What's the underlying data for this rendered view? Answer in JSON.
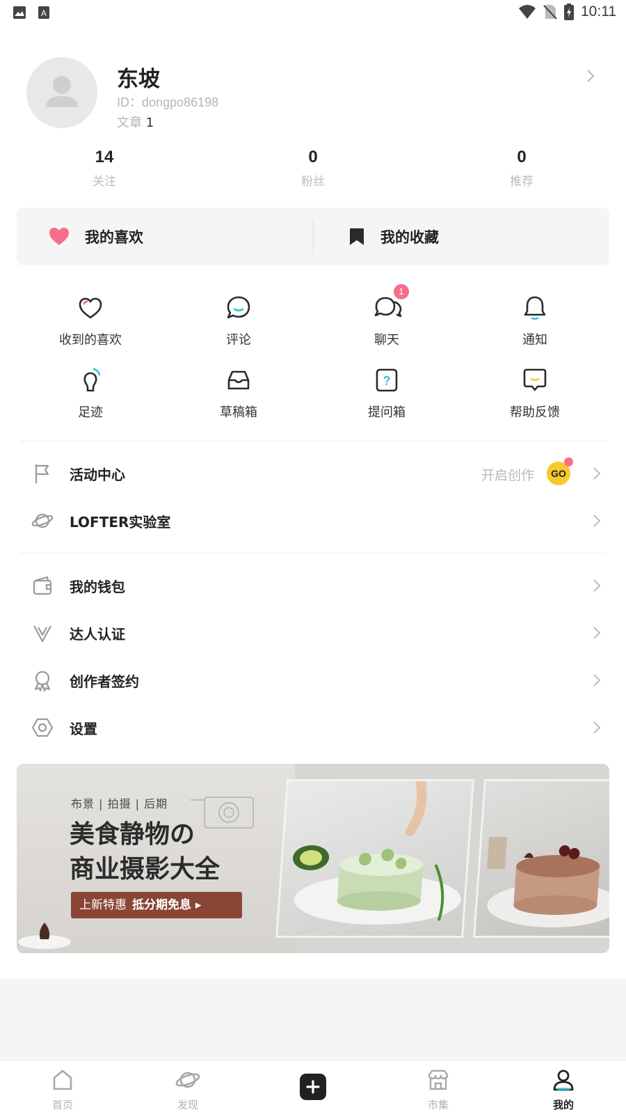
{
  "status_bar": {
    "time": "10:11"
  },
  "profile": {
    "name": "东坡",
    "id_text": "ID：dongpo86198",
    "articles_label": "文章",
    "articles_count": "1"
  },
  "stats": [
    {
      "num": "14",
      "label": "关注"
    },
    {
      "num": "0",
      "label": "粉丝"
    },
    {
      "num": "0",
      "label": "推荐"
    }
  ],
  "card": {
    "likes_label": "我的喜欢",
    "collections_label": "我的收藏"
  },
  "grid": [
    {
      "label": "收到的喜欢",
      "icon": "heart-outline-icon"
    },
    {
      "label": "评论",
      "icon": "comment-icon"
    },
    {
      "label": "聊天",
      "icon": "chat-icon",
      "badge": "1"
    },
    {
      "label": "通知",
      "icon": "bell-icon"
    },
    {
      "label": "足迹",
      "icon": "footprint-icon"
    },
    {
      "label": "草稿箱",
      "icon": "draft-box-icon"
    },
    {
      "label": "提问箱",
      "icon": "question-box-icon"
    },
    {
      "label": "帮助反馈",
      "icon": "feedback-icon"
    }
  ],
  "menu1": [
    {
      "label": "活动中心",
      "right_text": "开启创作",
      "go": "GO",
      "icon": "flag-icon"
    },
    {
      "label": "LOFTER实验室",
      "icon": "planet-icon"
    }
  ],
  "menu2": [
    {
      "label": "我的钱包",
      "icon": "wallet-icon"
    },
    {
      "label": "达人认证",
      "icon": "verified-icon"
    },
    {
      "label": "创作者签约",
      "icon": "award-icon"
    },
    {
      "label": "设置",
      "icon": "settings-icon"
    }
  ],
  "banner": {
    "tags": "布景 | 拍摄 | 后期",
    "title_line1": "美食静物の",
    "title_line2": "商业摄影大全",
    "cta_text": "上新特惠",
    "cta_bold": "抵分期免息 ▸"
  },
  "nav": [
    {
      "label": "首页",
      "icon": "home-icon"
    },
    {
      "label": "发现",
      "icon": "discover-icon"
    },
    {
      "label": "",
      "icon": "plus-icon"
    },
    {
      "label": "市集",
      "icon": "market-icon"
    },
    {
      "label": "我的",
      "icon": "profile-icon",
      "active": true
    }
  ],
  "colors": {
    "accent_pink": "#f56f8a",
    "go_yellow": "#f7c92a",
    "cta_brown": "#8a4536",
    "teal": "#33c3d6"
  }
}
